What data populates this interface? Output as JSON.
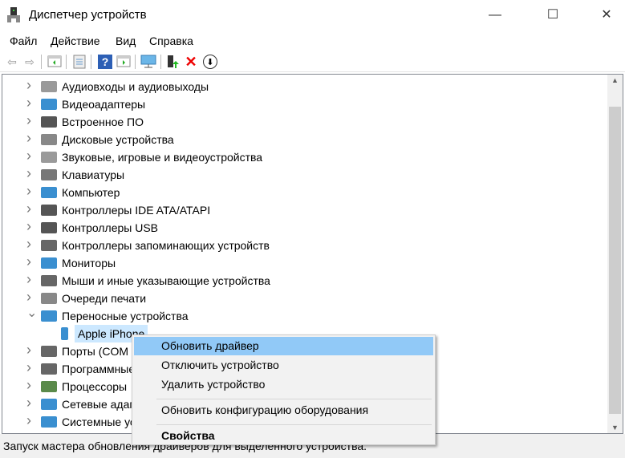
{
  "window": {
    "title": "Диспетчер устройств",
    "controls": [
      "—",
      "☐",
      "✕"
    ]
  },
  "menu": [
    "Файл",
    "Действие",
    "Вид",
    "Справка"
  ],
  "toolbar": [
    "back-icon",
    "forward-icon",
    "show-hide-console-tree-icon",
    "properties-icon",
    "help-icon",
    "action-pane-icon",
    "scan-hardware-icon",
    "update-driver-icon",
    "uninstall-icon",
    "disable-icon"
  ],
  "tree": [
    {
      "label": "Аудиовходы и аудиовыходы",
      "expanded": false,
      "color": "#9a9a9a"
    },
    {
      "label": "Видеоадаптеры",
      "expanded": false,
      "color": "#3a8fd0"
    },
    {
      "label": "Встроенное ПО",
      "expanded": false,
      "color": "#555555"
    },
    {
      "label": "Дисковые устройства",
      "expanded": false,
      "color": "#888888"
    },
    {
      "label": "Звуковые, игровые и видеоустройства",
      "expanded": false,
      "color": "#9a9a9a"
    },
    {
      "label": "Клавиатуры",
      "expanded": false,
      "color": "#777777"
    },
    {
      "label": "Компьютер",
      "expanded": false,
      "color": "#3a8fd0"
    },
    {
      "label": "Контроллеры IDE ATA/ATAPI",
      "expanded": false,
      "color": "#555555"
    },
    {
      "label": "Контроллеры USB",
      "expanded": false,
      "color": "#555555"
    },
    {
      "label": "Контроллеры запоминающих устройств",
      "expanded": false,
      "color": "#666666"
    },
    {
      "label": "Мониторы",
      "expanded": false,
      "color": "#3a8fd0"
    },
    {
      "label": "Мыши и иные указывающие устройства",
      "expanded": false,
      "color": "#666666"
    },
    {
      "label": "Очереди печати",
      "expanded": false,
      "color": "#888888"
    },
    {
      "label": "Переносные устройства",
      "expanded": true,
      "color": "#3a8fd0"
    },
    {
      "label": "Apple iPhone",
      "child": true,
      "selected": true,
      "color": "#3a8fd0"
    },
    {
      "label": "Порты (COM и LPT)",
      "expanded": false,
      "color": "#666666"
    },
    {
      "label": "Программные устройства",
      "expanded": false,
      "color": "#666666"
    },
    {
      "label": "Процессоры",
      "expanded": false,
      "color": "#5a8a4a"
    },
    {
      "label": "Сетевые адаптеры",
      "expanded": false,
      "color": "#3a8fd0"
    },
    {
      "label": "Системные устройства",
      "expanded": false,
      "color": "#3a8fd0"
    }
  ],
  "context_menu": [
    {
      "label": "Обновить драйвер",
      "highlighted": true
    },
    {
      "label": "Отключить устройство"
    },
    {
      "label": "Удалить устройство"
    },
    {
      "separator": true
    },
    {
      "label": "Обновить конфигурацию оборудования"
    },
    {
      "separator": true
    },
    {
      "label": "Свойства",
      "bold": true
    }
  ],
  "status": "Запуск мастера обновления драйверов для выделенного устройства.",
  "colors": {
    "highlight": "#91c9f7",
    "selection": "#cce8ff"
  }
}
